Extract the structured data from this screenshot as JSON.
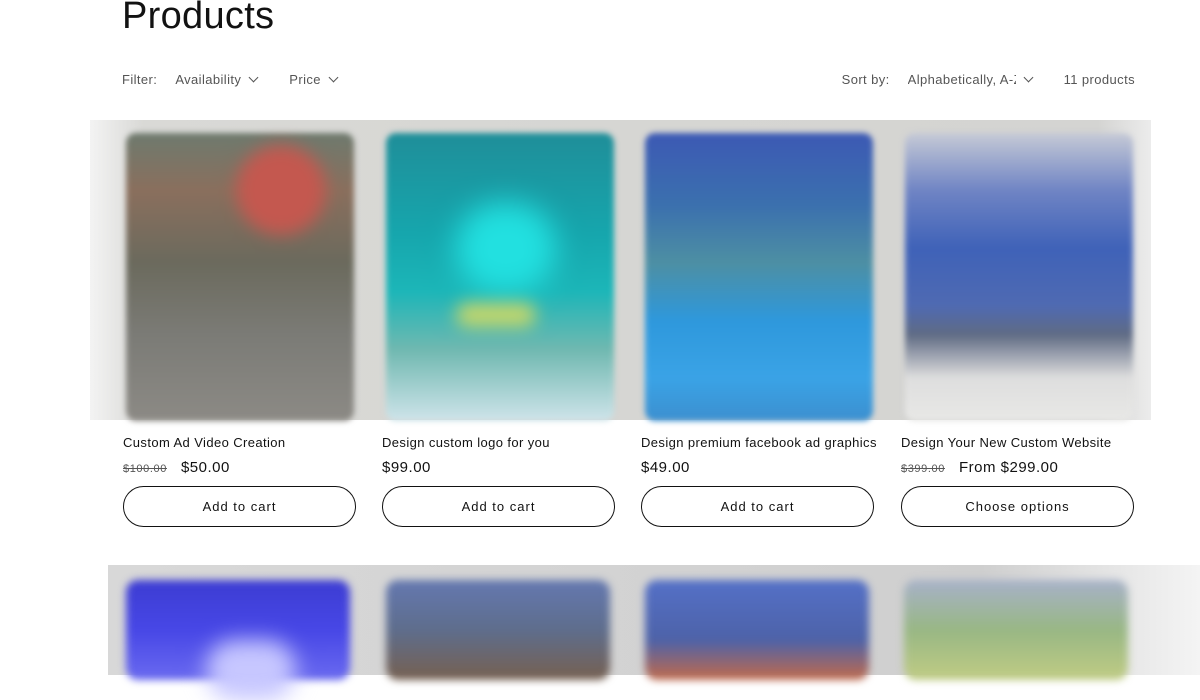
{
  "page": {
    "title": "Products"
  },
  "toolbar": {
    "filter_label": "Filter:",
    "facets": [
      {
        "label": "Availability"
      },
      {
        "label": "Price"
      }
    ],
    "sort_label": "Sort by:",
    "sort_value": "Alphabetically, A-Z",
    "product_count": "11 products"
  },
  "products": [
    {
      "title": "Custom Ad Video Creation",
      "compare_price": "$100.00",
      "price": "$50.00",
      "button": "Add to cart"
    },
    {
      "title": "Design custom logo for you",
      "compare_price": "",
      "price": "$99.00",
      "button": "Add to cart"
    },
    {
      "title": "Design premium facebook ad graphics",
      "compare_price": "",
      "price": "$49.00",
      "button": "Add to cart"
    },
    {
      "title": "Design Your New Custom Website",
      "compare_price": "$399.00",
      "price": "From $299.00",
      "button": "Choose options"
    }
  ],
  "icons": {
    "facet_dropdown": "chevron-down-icon",
    "sort_dropdown": "chevron-down-icon"
  }
}
